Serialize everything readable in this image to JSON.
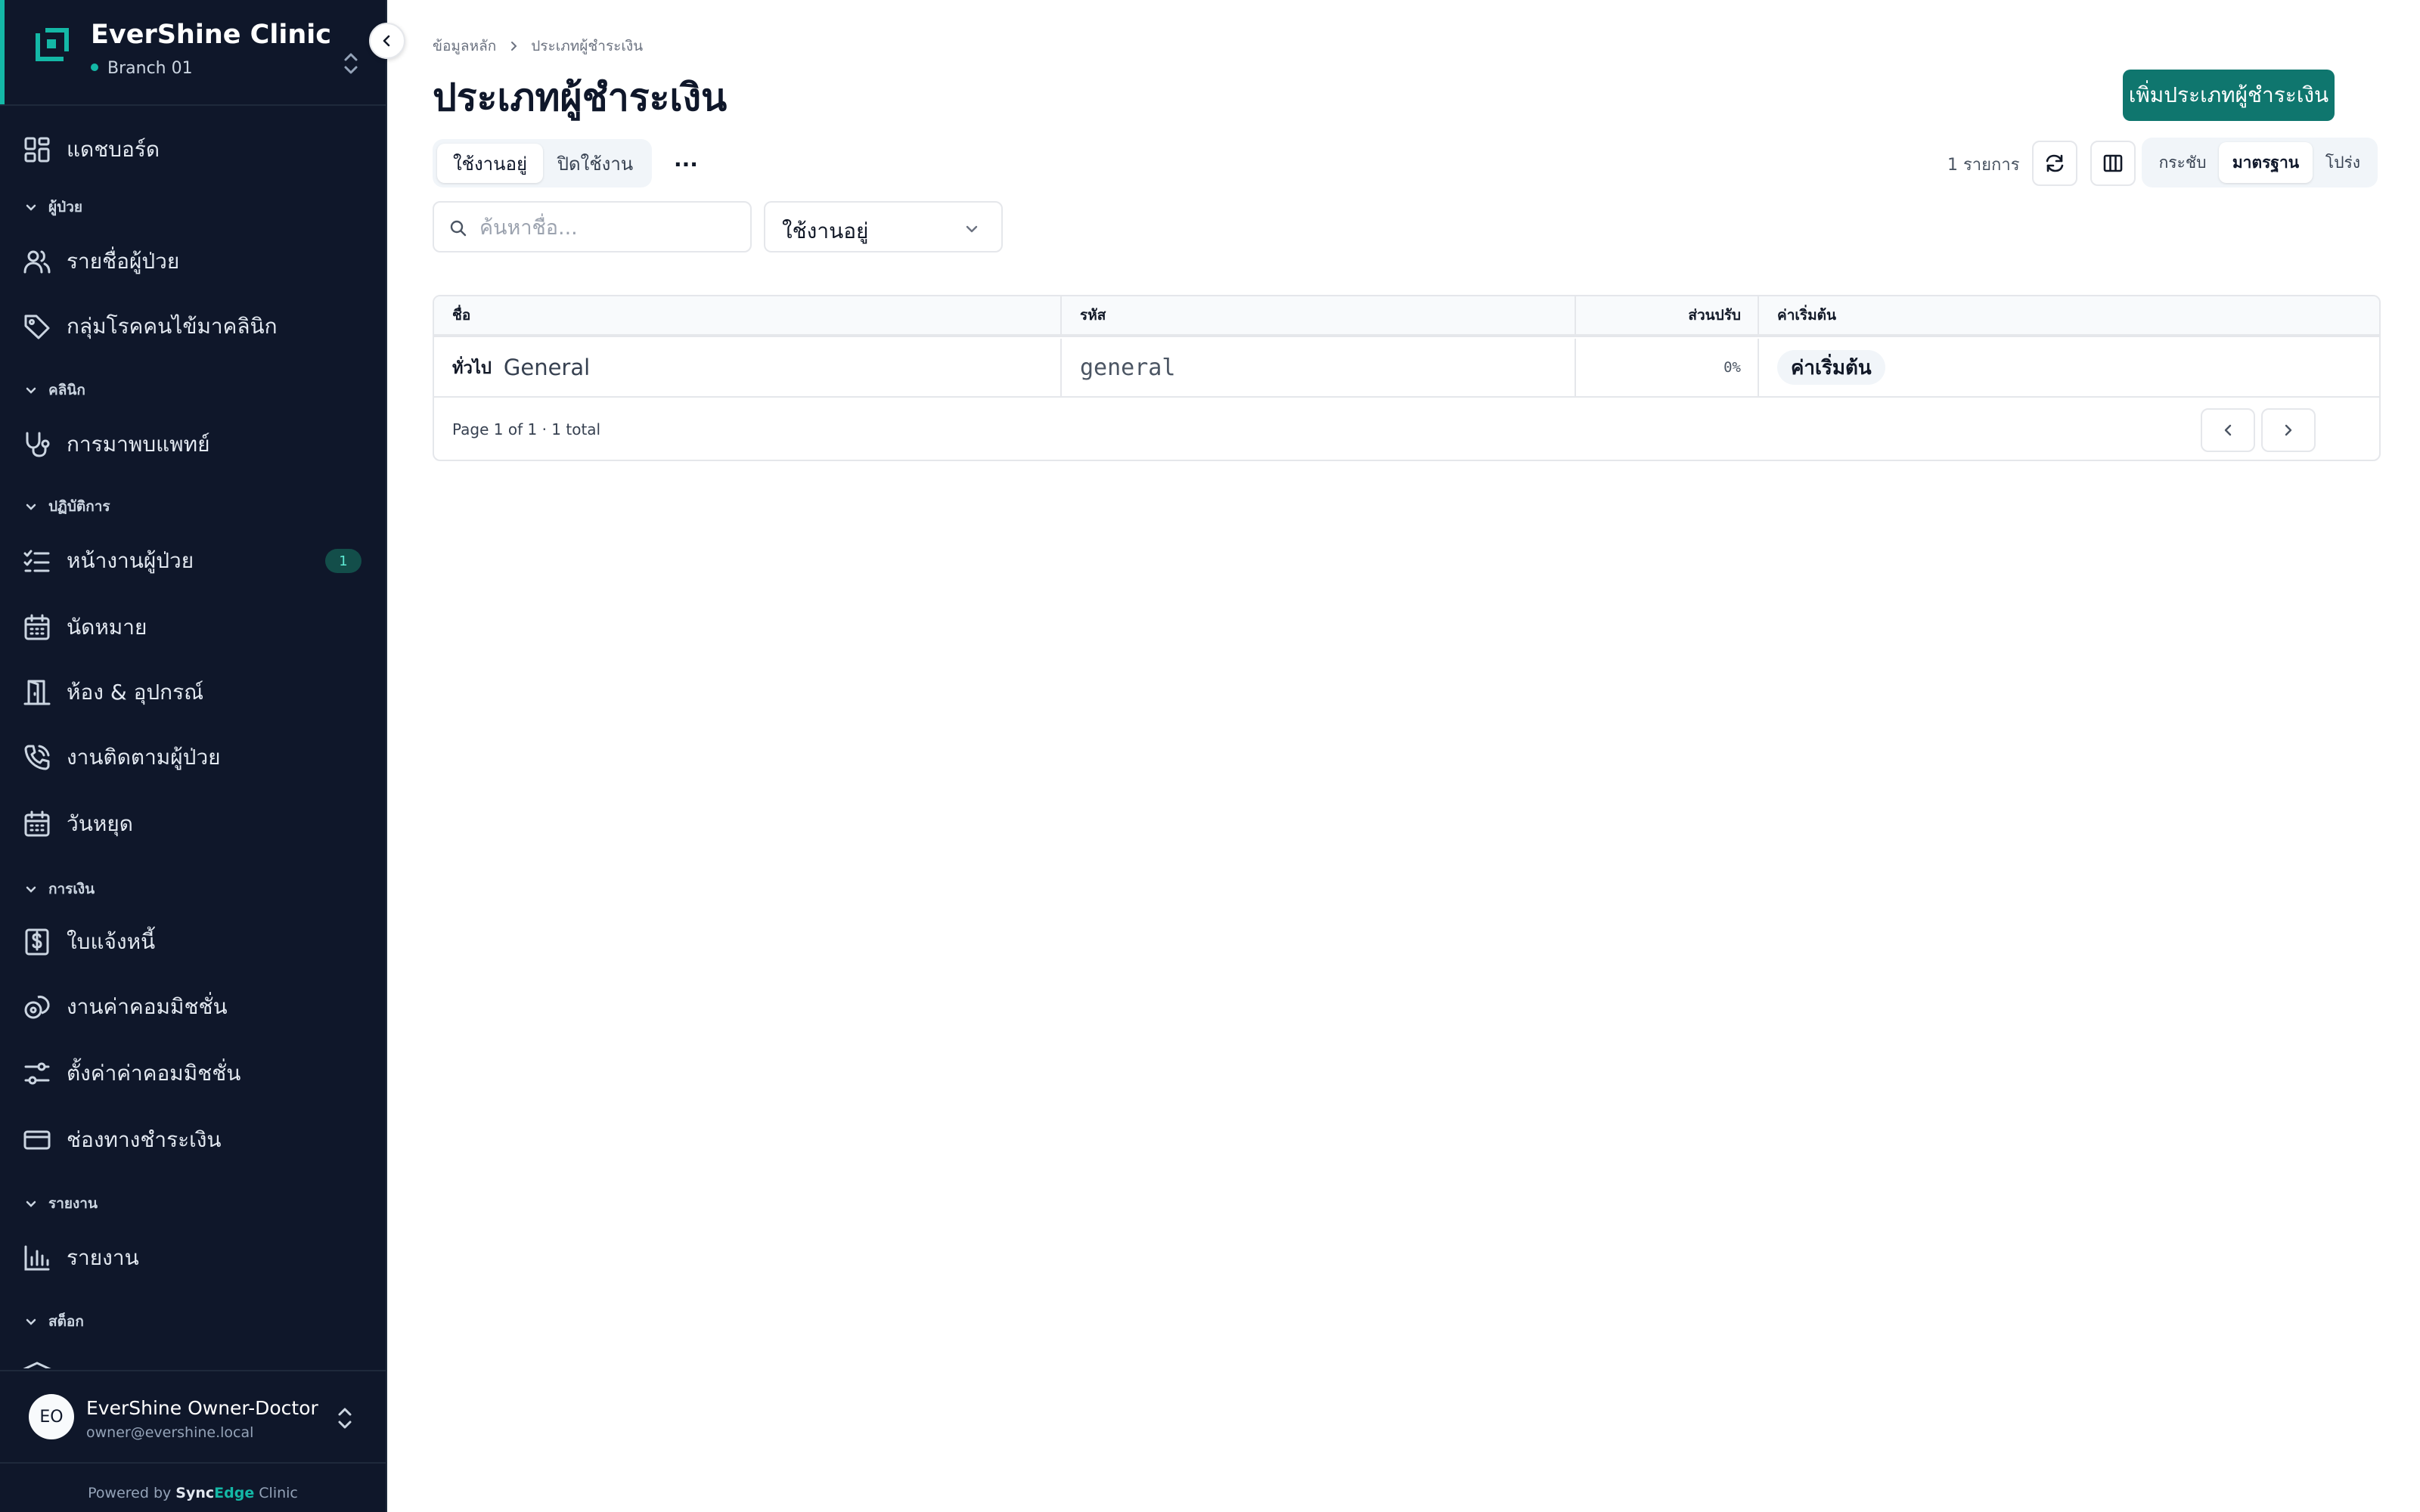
{
  "sidebar": {
    "brand": "EverShine Clinic",
    "branch": "Branch 01",
    "items": {
      "dashboard": "แดชบอร์ด",
      "patient_list": "รายชื่อผู้ป่วย",
      "disease_groups": "กลุ่มโรคคนไข้มาคลินิก",
      "doctor_visits": "การมาพบแพทย์",
      "patient_worklist": "หน้างานผู้ป่วย",
      "appointments": "นัดหมาย",
      "rooms_equipment": "ห้อง & อุปกรณ์",
      "patient_followup": "งานติดตามผู้ป่วย",
      "holidays": "วันหยุด",
      "invoices": "ใบแจ้งหนี้",
      "commission_work": "งานค่าคอมมิชชั่น",
      "commission_settings": "ตั้งค่าค่าคอมมิชชั่น",
      "payment_channels": "ช่องทางชำระเงิน",
      "reports": "รายงาน"
    },
    "worklist_badge": "1",
    "sections": {
      "patients": "ผู้ป่วย",
      "clinic": "คลินิก",
      "operations": "ปฏิบัติการ",
      "finance": "การเงิน",
      "reports": "รายงาน",
      "stock": "สต็อก"
    },
    "user": {
      "initials": "EO",
      "name": "EverShine Owner-Doctor",
      "email": "owner@evershine.local"
    },
    "powered": {
      "prefix": "Powered by",
      "brand_a": "Sync",
      "brand_b": "Edge",
      "suffix": "Clinic"
    }
  },
  "header": {
    "breadcrumb": [
      "ข้อมูลหลัก",
      "ประเภทผู้ชำระเงิน"
    ],
    "title": "ประเภทผู้ชำระเงิน",
    "add_button": "เพิ่มประเภทผู้ชำระเงิน"
  },
  "toolbar": {
    "status_tabs": [
      "ใช้งานอยู่",
      "ปิดใช้งาน"
    ],
    "more": "···",
    "count": "1 รายการ",
    "density": [
      "กระชับ",
      "มาตรฐาน",
      "โปร่ง"
    ]
  },
  "filters": {
    "search_placeholder": "ค้นหาชื่อ...",
    "status_value": "ใช้งานอยู่"
  },
  "table": {
    "columns": [
      "ชื่อ",
      "รหัส",
      "ส่วนปรับ",
      "ค่าเริ่มต้น"
    ],
    "rows": [
      {
        "name_th": "ทั่วไป",
        "name_en": "General",
        "code": "general",
        "adjustment": "0%",
        "default": "ค่าเริ่มต้น"
      }
    ],
    "row_more": "···",
    "pagination": "Page 1 of 1 · 1 total"
  },
  "colors": {
    "sidebar_bg": "#0f172a",
    "accent": "#14b8a6",
    "primary_button": "#0f766e"
  }
}
